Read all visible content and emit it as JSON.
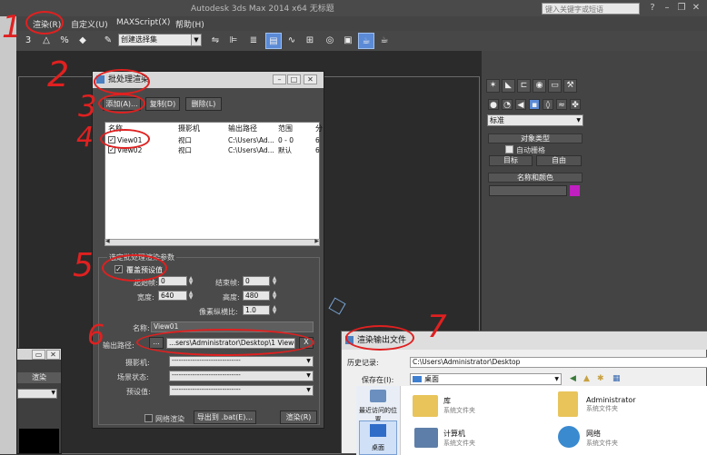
{
  "app": {
    "window_title": "Autodesk 3ds Max 2014 x64    无标题",
    "search_placeholder": "键入关键字或短语"
  },
  "menu": {
    "items": [
      "渲染(R)",
      "自定义(U)",
      "MAXScript(X)",
      "帮助(H)"
    ]
  },
  "toolbar": {
    "selection_set": "创建选择集",
    "snap_label": "3",
    "angle_snap": "△",
    "percent_snap": "%",
    "spinner_snap": "◆"
  },
  "command_panel": {
    "category": "标准",
    "object_type_header": "对象类型",
    "autogrid_label": "自动栅格",
    "btn_target": "目标",
    "btn_free": "自由",
    "name_color_header": "名称和颜色",
    "color": "#c020c0"
  },
  "batch_dialog": {
    "title": "批处理渲染",
    "add_button": "添加(A)...",
    "copy_button": "复制(D)",
    "delete_button": "删除(L)",
    "columns": [
      "名称",
      "摄影机",
      "输出路径",
      "范围",
      "分"
    ],
    "rows": [
      {
        "checked": true,
        "name": "View01",
        "camera": "视口",
        "path": "C:\\Users\\Ad...",
        "range": "0 - 0",
        "extra": "6"
      },
      {
        "checked": true,
        "name": "View02",
        "camera": "视口",
        "path": "C:\\Users\\Ad...",
        "range": "默认",
        "extra": "6"
      }
    ],
    "params_title": "选定批处理渲染参数",
    "override_preset": "覆盖预设值",
    "start_frame_label": "起始帧:",
    "start_frame": "0",
    "end_frame_label": "结束帧:",
    "end_frame": "0",
    "width_label": "宽度:",
    "width": "640",
    "height_label": "高度:",
    "height": "480",
    "pixel_aspect_label": "像素纵横比:",
    "pixel_aspect": "1.0",
    "name_label": "名称:",
    "name_value": "View01",
    "output_path_label": "输出路径:",
    "browse_button": "...",
    "output_path_value": "...sers\\Administrator\\Desktop\\1  View01.tif",
    "clear_button": "X",
    "camera_label": "摄影机:",
    "scene_state_label": "场景状态:",
    "preset_label": "预设值:",
    "net_render": "网络渲染",
    "export_bat": "导出到 .bat(E)...",
    "render_button": "渲染(R)"
  },
  "output_dialog": {
    "title": "渲染输出文件",
    "history_label": "历史记录:",
    "history_value": "C:\\Users\\Administrator\\Desktop",
    "save_in_label": "保存在(I):",
    "save_in_value": "桌面",
    "nav_recent": "最近访问的位置",
    "nav_desktop": "桌面",
    "items": [
      {
        "name": "库",
        "type": "系统文件夹"
      },
      {
        "name": "Administrator",
        "type": "系统文件夹"
      },
      {
        "name": "计算机",
        "type": "系统文件夹"
      },
      {
        "name": "网络",
        "type": "系统文件夹"
      }
    ]
  },
  "side_window": {
    "render_label": "渲染"
  },
  "annotations": {
    "n1": "1",
    "n2": "2",
    "n3": "3",
    "n4": "4",
    "n5": "5",
    "n6": "6",
    "n7": "7"
  }
}
